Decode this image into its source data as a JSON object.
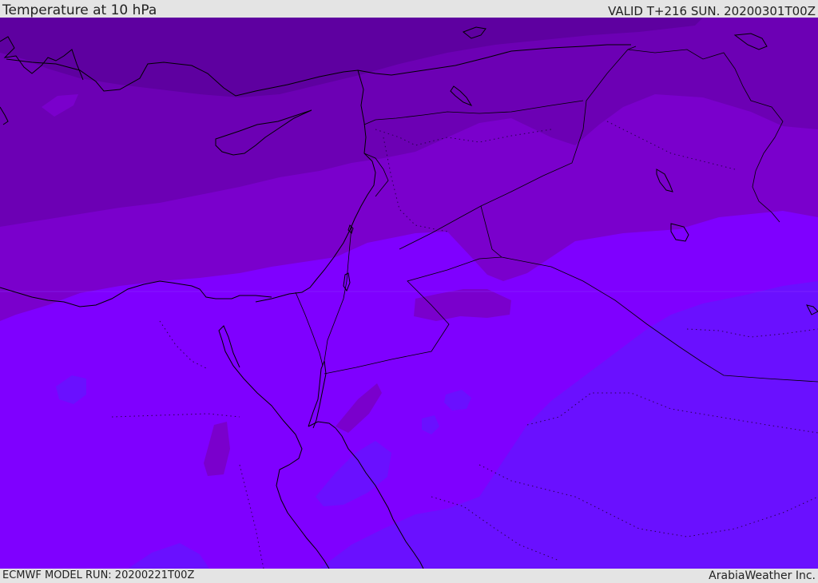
{
  "header": {
    "title": "Temperature at 10 hPa",
    "valid_time": "VALID T+216 SUN. 20200301T00Z"
  },
  "footer": {
    "model_run": "ECMWF MODEL RUN: 20200221T00Z",
    "credit": "ArabiaWeather Inc."
  },
  "map": {
    "variable": "temperature",
    "level": "10 hPa",
    "coastline_color": "#000000",
    "colors": {
      "coldest_band": "#5e00a0",
      "band_2": "#6c00b4",
      "band_3": "#7a00cc",
      "band_4": "#7f00ff",
      "warmest_band": "#6a10ff"
    }
  }
}
